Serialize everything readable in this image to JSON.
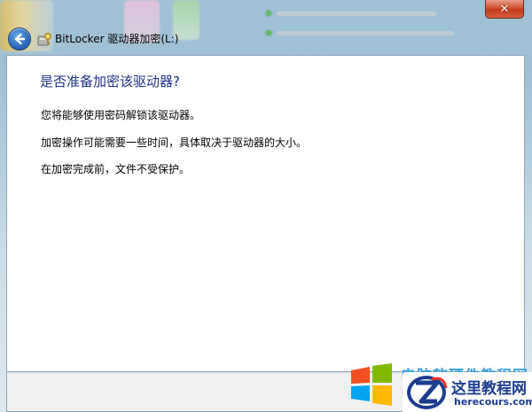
{
  "window": {
    "title": "BitLocker 驱动器加密(L:)",
    "close_label": "✕"
  },
  "content": {
    "heading": "是否准备加密该驱动器?",
    "paragraphs": [
      "您将能够使用密码解锁该驱动器。",
      "加密操作可能需要一些时间，具体取决于驱动器的大小。",
      "在加密完成前，文件不受保护。"
    ]
  },
  "watermark": {
    "cn_text": "电脑软硬件教程网",
    "site_name": "这里教程网",
    "site_url": "herecours.com"
  },
  "icons": {
    "back": "back-arrow-icon",
    "app": "bitlocker-key-icon",
    "close": "close-icon",
    "windows_logo": "windows-logo-icon",
    "site_logo": "z-logo-icon"
  },
  "colors": {
    "heading": "#1e3287",
    "close_button": "#c13a1b",
    "back_button": "#2f6fbf",
    "watermark_blue": "#2596d8"
  }
}
